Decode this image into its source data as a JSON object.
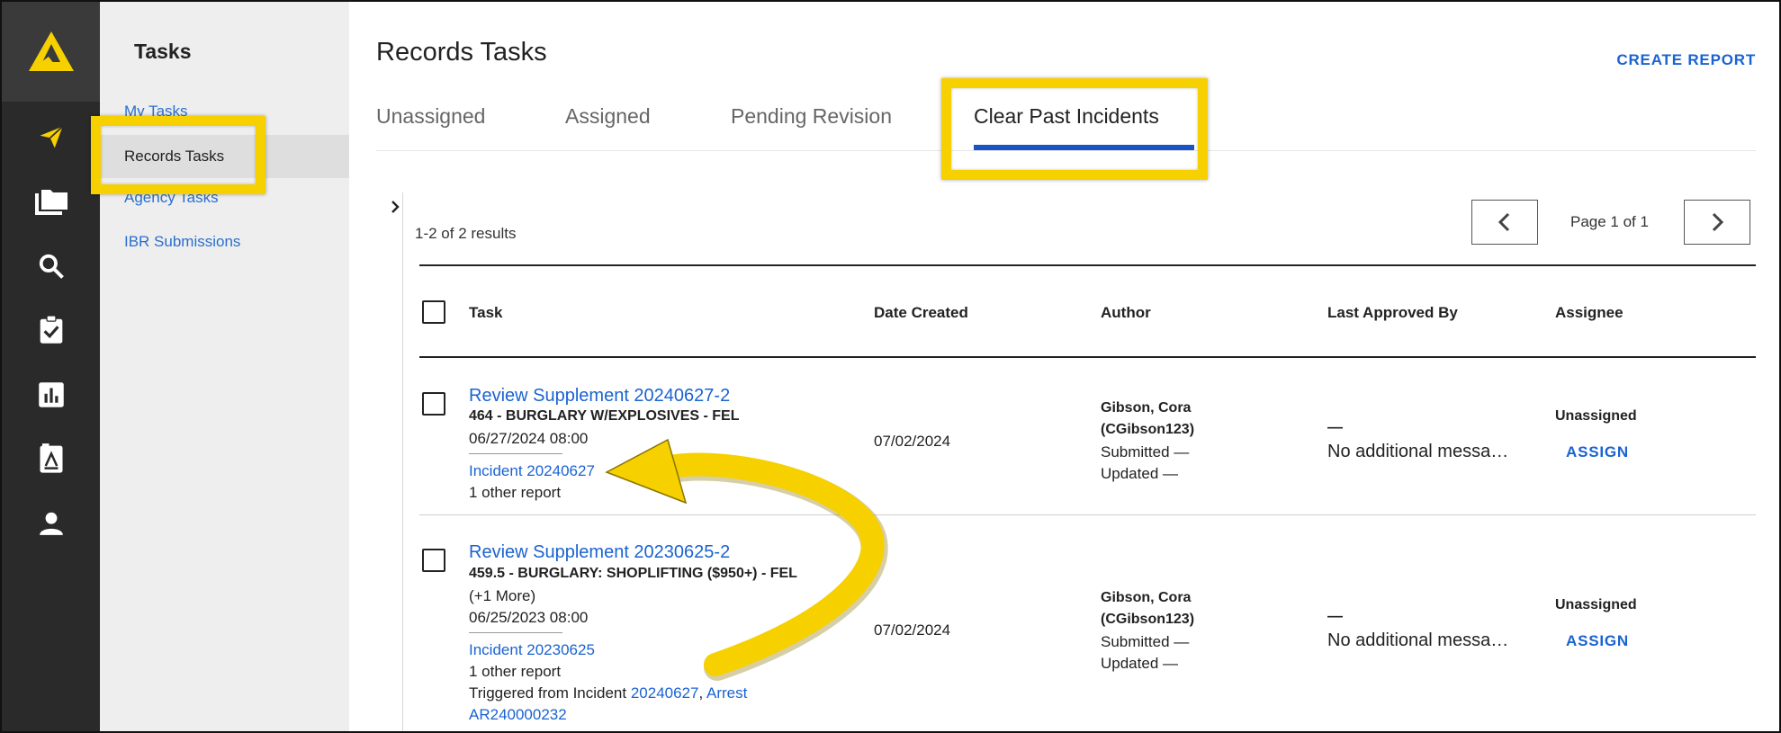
{
  "sidebar": {
    "title": "Tasks",
    "items": [
      {
        "label": "My Tasks"
      },
      {
        "label": "Records Tasks"
      },
      {
        "label": "Agency Tasks"
      },
      {
        "label": "IBR Submissions"
      }
    ]
  },
  "rail_icons": [
    "logo-icon",
    "send-icon",
    "folder-icon",
    "search-icon",
    "clipboard-check-icon",
    "bar-chart-icon",
    "report-icon",
    "person-icon"
  ],
  "main": {
    "title": "Records Tasks",
    "create_report": "CREATE REPORT",
    "tabs": [
      {
        "label": "Unassigned"
      },
      {
        "label": "Assigned"
      },
      {
        "label": "Pending Revision"
      },
      {
        "label": "Clear Past Incidents",
        "active": true
      }
    ],
    "results_text": "1-2 of 2 results",
    "pagination": {
      "text": "Page 1 of 1"
    },
    "table": {
      "headers": [
        "Task",
        "Date Created",
        "Author",
        "Last Approved By",
        "Assignee"
      ],
      "rows": [
        {
          "title": "Review Supplement 20240627-2",
          "offense": "464 - BURGLARY W/EXPLOSIVES - FEL",
          "datetime": "06/27/2024 08:00",
          "incident": "Incident 20240627",
          "other": "1 other report",
          "date_created": "07/02/2024",
          "author_name": "Gibson, Cora",
          "author_id": "(CGibson123)",
          "submitted": "Submitted —",
          "updated": "Updated —",
          "approved_dash": "—",
          "approved_msg": "No additional messa…",
          "assignee": "Unassigned",
          "assign_label": "ASSIGN"
        },
        {
          "title": "Review Supplement 20230625-2",
          "offense": "459.5 - BURGLARY: SHOPLIFTING ($950+) - FEL",
          "more": "(+1 More)",
          "datetime": "06/25/2023 08:00",
          "incident": "Incident 20230625",
          "other": "1 other report",
          "triggered_prefix": "Triggered from Incident ",
          "triggered_incident": "20240627",
          "triggered_comma": ",",
          "triggered_arrest": "Arrest",
          "triggered_arrest_id": "AR240000232",
          "date_created": "07/02/2024",
          "author_name": "Gibson, Cora",
          "author_id": "(CGibson123)",
          "submitted": "Submitted —",
          "updated": "Updated —",
          "approved_dash": "—",
          "approved_msg": "No additional messa…",
          "assignee": "Unassigned",
          "assign_label": "ASSIGN"
        }
      ]
    }
  },
  "colors": {
    "highlight": "#f7d000",
    "link": "#1a63d1",
    "rail": "#2a2a2a",
    "accent_logo": "#f7d000"
  }
}
